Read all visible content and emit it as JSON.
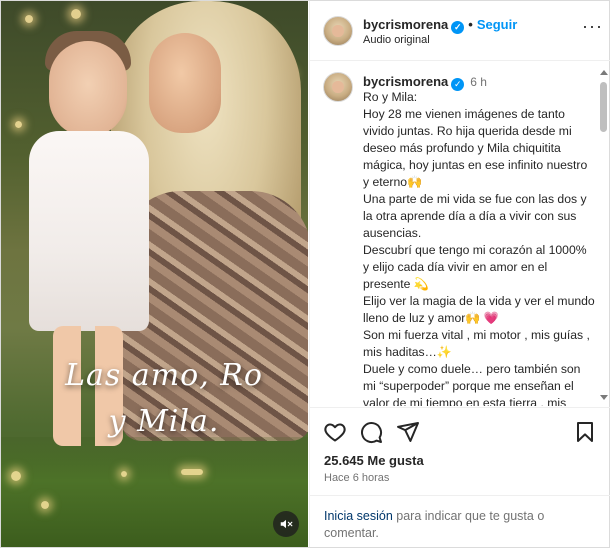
{
  "media": {
    "overlay_line1": "Las amo, Ro",
    "overlay_line2": "y Mila."
  },
  "header": {
    "username": "bycrismorena",
    "follow_label": "Seguir",
    "audio_label": "Audio original",
    "separator": "•"
  },
  "post": {
    "username": "bycrismorena",
    "time": "6 h",
    "caption_lines": [
      "Ro y Mila:",
      "Hoy 28 me vienen imágenes de tanto vivido juntas. Ro hija querida desde mi deseo más profundo y Mila chiquitita mágica, hoy juntas en ese infinito nuestro y eterno🙌",
      "Una parte de mi vida se fue con las dos y la otra aprende día a día a vivir con sus ausencias.",
      "Descubrí que tengo mi corazón al 1000% y elijo cada día vivir en amor en el presente 💫",
      "Elijo ver la magia de la vida y ver el mundo lleno de luz y amor🙌 💗",
      "Son mi fuerza vital , mi motor , mis guías , mis haditas…✨",
      "Duele y como duele… pero también son mi “superpoder” porque me enseñan el valor de mi tiempo en esta tierra , mis vínculos , mis deseos más auténticos!!"
    ]
  },
  "stats": {
    "likes": "25.645 Me gusta",
    "time_ago": "Hace 6 horas"
  },
  "login": {
    "link": "Inicia sesión",
    "rest": " para indicar que te gusta o comentar."
  }
}
